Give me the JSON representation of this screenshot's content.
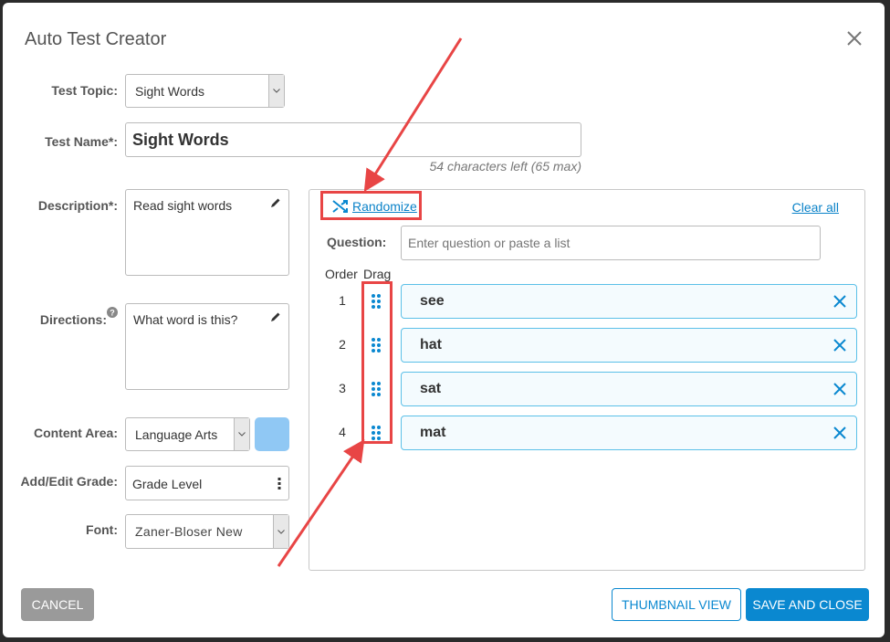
{
  "dialog": {
    "title": "Auto Test Creator",
    "close_icon": "close-icon"
  },
  "form": {
    "test_topic": {
      "label": "Test Topic:",
      "value": "Sight Words"
    },
    "test_name": {
      "label": "Test Name*:",
      "value": "Sight Words",
      "hint": "54 characters left (65 max)"
    },
    "description": {
      "label": "Description*:",
      "value": "Read sight words",
      "icon": "pencil-icon"
    },
    "directions": {
      "label": "Directions:",
      "value": "What word is this?",
      "icon": "pencil-icon",
      "help_icon": "question-circle-icon"
    },
    "content_area": {
      "label": "Content Area:",
      "value": "Language Arts",
      "swatch_color": "#90c8f4"
    },
    "grade": {
      "label": "Add/Edit Grade:",
      "value": "Grade Level",
      "icon": "vertical-ellipsis-icon"
    },
    "font": {
      "label": "Font:",
      "value": "Zaner-Bloser New"
    }
  },
  "questions": {
    "randomize_label": "Randomize",
    "randomize_icon": "shuffle-icon",
    "clear_all_label": "Clear all",
    "question_label": "Question:",
    "question_placeholder": "Enter question or paste a list",
    "order_header": "Order",
    "drag_header": "Drag",
    "items": [
      {
        "order": "1",
        "word": "see"
      },
      {
        "order": "2",
        "word": "hat"
      },
      {
        "order": "3",
        "word": "sat"
      },
      {
        "order": "4",
        "word": "mat"
      }
    ]
  },
  "footer": {
    "cancel_label": "CANCEL",
    "thumbnail_label": "THUMBNAIL VIEW",
    "save_label": "SAVE AND CLOSE"
  },
  "colors": {
    "accent": "#0a88d0",
    "annotation": "#e84545",
    "cancel_bg": "#9a9a9a"
  }
}
